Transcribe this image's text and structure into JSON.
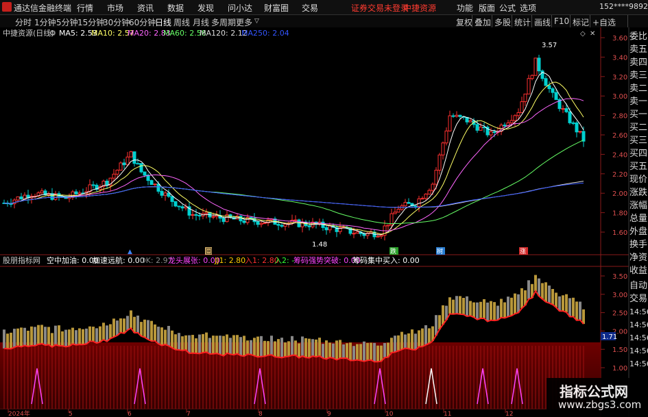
{
  "app": {
    "title": "通达信金融终端",
    "logo_icon": "tdx-logo-icon"
  },
  "menu": [
    "行情",
    "市场",
    "资讯",
    "数据",
    "发现",
    "问小达",
    "财富圈",
    "交易"
  ],
  "alerts": [
    "证券交易未登录",
    "中捷资源"
  ],
  "right_menu": [
    "功能",
    "版面",
    "公式",
    "选项"
  ],
  "user_id": "152****9892",
  "window_controls": "─ □ ✕",
  "periods": [
    "分时",
    "1分钟",
    "5分钟",
    "15分钟",
    "30分钟",
    "60分钟",
    "日线",
    "周线",
    "月线",
    "多周期",
    "更多"
  ],
  "active_period": "日线",
  "tools": [
    "复权",
    "叠加",
    "多股",
    "统计",
    "画线",
    "F10",
    "标记",
    "+自选"
  ],
  "stock_label": "中捷资源(日线)",
  "ma_legend": [
    {
      "text": "MA5: 2.53",
      "color": "#ffffff"
    },
    {
      "text": "MA10: 2.57",
      "color": "#ffff66"
    },
    {
      "text": "MA20: 2.83",
      "color": "#ff66ff"
    },
    {
      "text": "MA60: 2.58",
      "color": "#66ff66"
    },
    {
      "text": "MA120: 2.12",
      "color": "#dddddd"
    },
    {
      "text": "MA250: 2.04",
      "color": "#3355ff"
    }
  ],
  "price_axis": [
    "3.60",
    "3.40",
    "3.20",
    "3.00",
    "2.80",
    "2.60",
    "2.40",
    "2.20",
    "2.00",
    "1.80",
    "1.60"
  ],
  "price_high_label": "3.57",
  "price_low_label": "1.48",
  "markers": [
    {
      "text": "回"
    },
    {
      "text": "跌"
    },
    {
      "text": "树"
    },
    {
      "text": "涨"
    }
  ],
  "indicator": {
    "name": "股朋指标网",
    "items": [
      {
        "text": "空中加油: 0.00",
        "color": "#ffffff"
      },
      {
        "text": "加速远航: 0.00",
        "color": "#ffffff"
      },
      {
        "text": "OK: 2.97",
        "color": "#888888"
      },
      {
        "text": "龙头展张: 0.00",
        "color": "#ff44ff"
      },
      {
        "text": "JJ1: 2.80",
        "color": "#ffcc00"
      },
      {
        "text": "入1: 2.80",
        "color": "#ff3030"
      },
      {
        "text": "入2: -",
        "color": "#33ff33"
      },
      {
        "text": "筹码强势突破: 0.00",
        "color": "#ff44ff"
      },
      {
        "text": "筹码集中买入: 0.00",
        "color": "#ffffff"
      }
    ],
    "axis": [
      "3.50",
      "3.00",
      "2.50",
      "2.00",
      "1.50",
      "1.00"
    ],
    "current_badge": "1.71"
  },
  "date_axis": [
    "2024年",
    "5",
    "6",
    "7",
    "8",
    "9",
    "10",
    "11",
    "12"
  ],
  "side_panel": [
    "委比",
    "卖五",
    "卖四",
    "卖三",
    "卖二",
    "卖一",
    "买一",
    "买二",
    "买三",
    "买四",
    "买五",
    "现价",
    "涨跌",
    "涨幅",
    "总量",
    "外盘",
    "换手",
    "净资",
    "收益"
  ],
  "side_panel_lower": [
    "自动",
    "交易",
    "14:56",
    "14:56",
    "14:56",
    "14:56",
    "14:56",
    "14:56",
    "14:56"
  ],
  "watermark": {
    "line1": "指标公式网",
    "line2": "www.zbgs3.com"
  }
}
